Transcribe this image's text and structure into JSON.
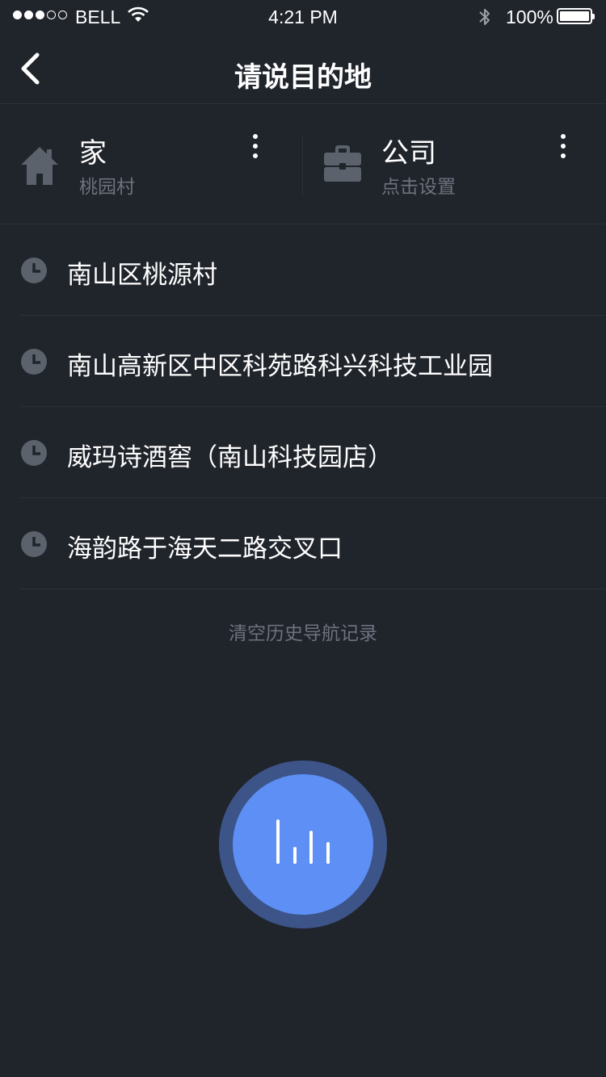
{
  "status_bar": {
    "carrier": "BELL",
    "time": "4:21 PM",
    "battery": "100%",
    "signal_bars_filled": 3,
    "signal_bars_total": 5
  },
  "nav": {
    "title": "请说目的地",
    "back_icon": "chevron-left-icon"
  },
  "shortcuts": {
    "home": {
      "title": "家",
      "subtitle": "桃园村",
      "icon": "house-icon"
    },
    "work": {
      "title": "公司",
      "subtitle": "点击设置",
      "icon": "briefcase-icon"
    }
  },
  "history": [
    {
      "text": "南山区桃源村",
      "icon": "clock-icon"
    },
    {
      "text": "南山高新区中区科苑路科兴科技工业园",
      "icon": "clock-icon"
    },
    {
      "text": "威玛诗酒窖（南山科技园店）",
      "icon": "clock-icon"
    },
    {
      "text": "海韵路于海天二路交叉口",
      "icon": "clock-icon"
    }
  ],
  "clear_history_label": "清空历史导航记录",
  "colors": {
    "background": "#20242b",
    "divider": "#2c3139",
    "muted_text": "#6c737d",
    "icon_gray": "#5b626c",
    "voice_button": "#5d8ff5",
    "voice_ring": "#3c5488"
  },
  "voice_icon": "sound-wave-icon"
}
